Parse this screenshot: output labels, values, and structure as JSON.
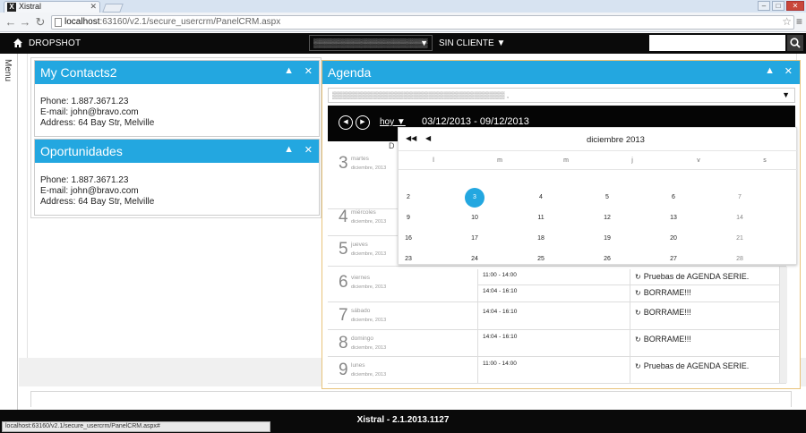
{
  "browser": {
    "tab_title": "Xistral",
    "tab_favicon": "X",
    "url_host": "localhost",
    "url_rest": ":63160/v2.1/secure_usercrm/PanelCRM.aspx",
    "back_glyph": "←",
    "forward_glyph": "→",
    "reload_glyph": "↻",
    "star_glyph": "☆",
    "menu_glyph": "≡",
    "status_url": "localhost:63160/v2.1/secure_usercrm/PanelCRM.aspx#"
  },
  "appnav": {
    "brand": "DROPSHOT",
    "company_selector": "▒▒▒▒▒▒▒▒▒▒▒▒▒▒▒▒▒▒▒▒",
    "cliente": "SIN CLIENTE",
    "caret": "▼",
    "search_placeholder": ""
  },
  "menu_label": "Menu",
  "panel_controls": {
    "collapse": "▲",
    "close": "✕"
  },
  "contacts_panel": {
    "title": "My Contacts2",
    "lines": [
      "Phone: 1.887.3671.23",
      "E-mail: john@bravo.com",
      "Address: 64 Bay Str, Melville"
    ]
  },
  "oportunidades_panel": {
    "title": "Oportunidades",
    "lines": [
      "Phone: 1.887.3671.23",
      "E-mail: john@bravo.com",
      "Address: 64 Bay Str, Melville"
    ]
  },
  "agenda": {
    "title": "Agenda",
    "selector": "▒▒▒▒▒▒▒▒▒▒▒▒▒▒▒▒▒▒▒▒▒▒▒▒▒▒▒▒▒▒▒▒▒▒ ,",
    "prev": "◀",
    "next": "▶",
    "hoy": "hoy ▼",
    "range": "03/12/2013 - 09/12/2013",
    "d_letter": "D",
    "days": [
      {
        "num": "3",
        "name": "martes",
        "month": "diciembre, 2013"
      },
      {
        "num": "4",
        "name": "miércoles",
        "month": "diciembre, 2013"
      },
      {
        "num": "5",
        "name": "jueves",
        "month": "diciembre, 2013"
      },
      {
        "num": "6",
        "name": "viernes",
        "month": "diciembre, 2013"
      },
      {
        "num": "7",
        "name": "sábado",
        "month": "diciembre, 2013"
      },
      {
        "num": "8",
        "name": "domingo",
        "month": "diciembre, 2013"
      },
      {
        "num": "9",
        "name": "lunes",
        "month": "diciembre, 2013"
      }
    ],
    "events": [
      {
        "time": "11:00 - 14:00",
        "title": "Pruebas de AGENDA SERIE."
      },
      {
        "time": "14:04 - 16:10",
        "title": "BORRAME!!!"
      },
      {
        "time": "14:04 - 16:10",
        "title": "BORRAME!!!"
      },
      {
        "time": "14:04 - 16:10",
        "title": "BORRAME!!!"
      },
      {
        "time": "11:00 - 14:00",
        "title": "Pruebas de AGENDA SERIE."
      }
    ],
    "event_icon": "↻"
  },
  "calendar": {
    "prev_year": "◀◀",
    "prev_month": "◀",
    "month": "diciembre 2013",
    "weekdays": [
      "l",
      "m",
      "m",
      "j",
      "v",
      "s"
    ],
    "weeks": [
      [
        "2",
        "3",
        "4",
        "5",
        "6",
        "7"
      ],
      [
        "9",
        "10",
        "11",
        "12",
        "13",
        "14"
      ],
      [
        "16",
        "17",
        "18",
        "19",
        "20",
        "21"
      ],
      [
        "23",
        "24",
        "25",
        "26",
        "27",
        "28"
      ]
    ],
    "selected": "3"
  },
  "footer": "Xistral - 2.1.2013.1127",
  "colors": {
    "accent": "#23a7e0",
    "nav": "#0a0a0a",
    "agenda_border": "#e8c37a"
  }
}
